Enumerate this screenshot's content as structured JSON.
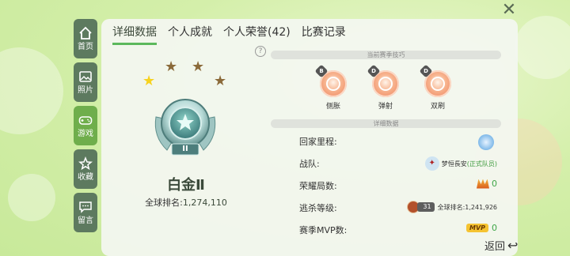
{
  "nav": [
    {
      "label": "首页",
      "icon": "home-icon",
      "active": false
    },
    {
      "label": "照片",
      "icon": "photo-icon",
      "active": false
    },
    {
      "label": "游戏",
      "icon": "gamepad-icon",
      "active": true
    },
    {
      "label": "收藏",
      "icon": "favorite-icon",
      "active": false
    },
    {
      "label": "留言",
      "icon": "message-icon",
      "active": false
    }
  ],
  "tabs": [
    {
      "label": "详细数据",
      "active": true
    },
    {
      "label": "个人成就",
      "active": false
    },
    {
      "label": "个人荣誉(42)",
      "active": false
    },
    {
      "label": "比赛记录",
      "active": false
    }
  ],
  "rank": {
    "name": "白金Ⅱ",
    "badge_numeral": "II",
    "global_label": "全球排名:",
    "global_value": "1,274,110",
    "stars_filled": 1,
    "stars_total": 4
  },
  "skills_header": "当前赛季技巧",
  "skills": [
    {
      "name": "侧胀",
      "grade": "B"
    },
    {
      "name": "弹射",
      "grade": "D"
    },
    {
      "name": "双刷",
      "grade": "D"
    }
  ],
  "details_header": "详细数据",
  "details": {
    "home": {
      "label": "回家里程:",
      "icon": "home-globe-icon"
    },
    "team": {
      "label": "战队:",
      "team_name": "梦恒長安",
      "team_role": "(正式队员)",
      "emblem": "✦"
    },
    "glory": {
      "label": "荣耀局数:",
      "value": "0"
    },
    "escape": {
      "label": "逃杀等级:",
      "level": "31",
      "rank_label": "全球排名:",
      "rank_value": "1,241,926"
    },
    "mvp": {
      "label": "赛季MVP数:",
      "tag": "MVP",
      "value": "0"
    }
  },
  "close_glyph": "✕",
  "back_label": "返回",
  "back_glyph": "↩",
  "help_glyph": "?",
  "colors": {
    "accent_green": "#6fae4c",
    "nav_bg": "#5d7a5f",
    "value_green": "#3fa648"
  }
}
